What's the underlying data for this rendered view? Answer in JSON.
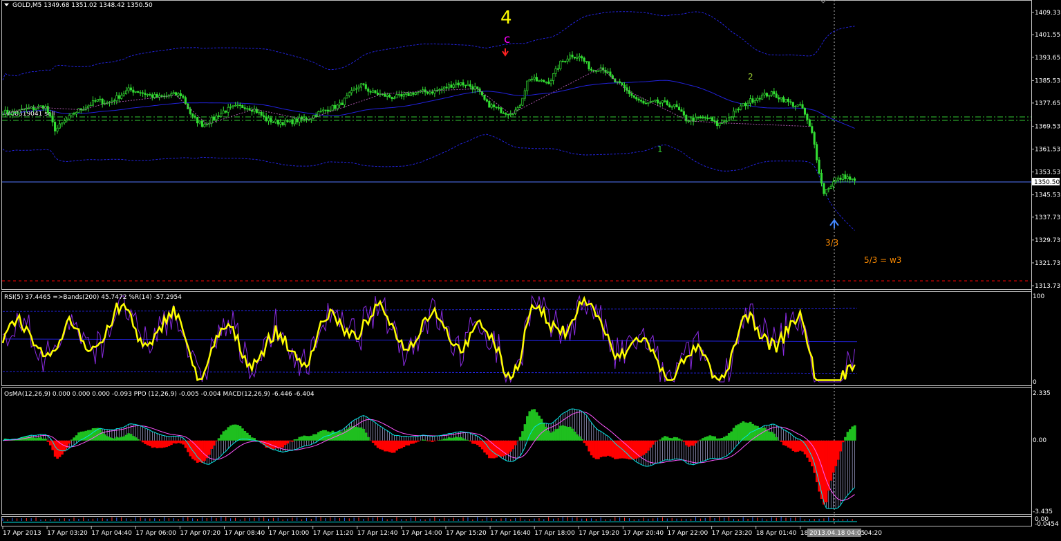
{
  "colors": {
    "background": "#000000",
    "candle": "#33dd33",
    "band": "#2222dd",
    "rsi": "#ffff00",
    "wpr": "#8a2be2",
    "osma_up": "#1fbf1f",
    "osma_down": "#ff0000",
    "macd": "#00e5e5",
    "signal": "#ff55ff",
    "hline_green": "#33cc33",
    "hline_red": "#ff0000",
    "zigzag": "#aa55aa"
  },
  "main": {
    "header": "GOLD,M5  1349.68 1351.02 1348.42 1350.50",
    "order_label": "#88319041 sell",
    "price_ticks": [
      "1409.33",
      "1401.55",
      "1393.65",
      "1385.53",
      "1377.65",
      "1369.53",
      "1361.53",
      "1353.53",
      "1345.53",
      "1337.73",
      "1329.73",
      "1321.73",
      "1313.73"
    ],
    "price_tag": "1350.50",
    "wave_labels": {
      "big4": "4",
      "c": "c",
      "one": "1",
      "two": "2",
      "three3": "3/3",
      "note": "5/3 = w3"
    }
  },
  "rsi_pane": {
    "header": "RSI(5) 37.4465  =>Bands(200) 45.7472  %R(14) -57.2954",
    "ticks": [
      "100",
      "0"
    ]
  },
  "macd_pane": {
    "header": "OsMA(12,26,9) 0.000 0.000 0.000 -0.093  PPO (12,26,9) -0.005 -0.004  MACD(12,26,9) -6.446 -6.404",
    "ticks": [
      "2.335",
      "0.00",
      "-3.435"
    ]
  },
  "bottom_pane": {
    "ticks": [
      "0.00",
      "-0.0454"
    ]
  },
  "time_axis": {
    "labels": [
      "17 Apr 2013",
      "17 Apr 03:20",
      "17 Apr 04:40",
      "17 Apr 06:00",
      "17 Apr 07:20",
      "17 Apr 08:40",
      "17 Apr 10:00",
      "17 Apr 11:20",
      "17 Apr 12:40",
      "17 Apr 14:00",
      "17 Apr 15:20",
      "17 Apr 16:40",
      "17 Apr 18:00",
      "17 Apr 19:20",
      "17 Apr 20:40",
      "17 Apr 22:00",
      "17 Apr 23:20",
      "18 Apr 01:40",
      "18"
    ],
    "cursor_label": "2013.04.18 04:05",
    "last_label": "04:20"
  },
  "chart_data": {
    "type": "candlestick",
    "symbol": "GOLD",
    "timeframe": "M5",
    "ohlc_last": {
      "open": 1349.68,
      "high": 1351.02,
      "low": 1348.42,
      "close": 1350.5
    },
    "ylim": [
      1313.73,
      1409.33
    ],
    "x_tick_labels": [
      "17 Apr 2013",
      "17 Apr 03:20",
      "17 Apr 04:40",
      "17 Apr 06:00",
      "17 Apr 07:20",
      "17 Apr 08:40",
      "17 Apr 10:00",
      "17 Apr 11:20",
      "17 Apr 12:40",
      "17 Apr 14:00",
      "17 Apr 15:20",
      "17 Apr 16:40",
      "17 Apr 18:00",
      "17 Apr 19:20",
      "17 Apr 20:40",
      "17 Apr 22:00",
      "17 Apr 23:20",
      "18 Apr 01:40",
      "18"
    ],
    "price_series": [
      1374.5,
      1374.0,
      1375.4,
      1375.8,
      1376.7,
      1368.2,
      1371.6,
      1374.7,
      1376.5,
      1378.6,
      1377.6,
      1379.9,
      1382.3,
      1381.6,
      1380.3,
      1379.5,
      1380.5,
      1380.6,
      1372.7,
      1370.0,
      1372.1,
      1374.8,
      1376.1,
      1376.5,
      1375.2,
      1371.9,
      1371.0,
      1370.8,
      1371.6,
      1372.2,
      1374.1,
      1375.7,
      1376.8,
      1380.6,
      1384.2,
      1381.5,
      1380.5,
      1379.7,
      1379.8,
      1381.3,
      1381.5,
      1381.7,
      1382.8,
      1384.6,
      1384.2,
      1382.7,
      1377.5,
      1375.5,
      1374.2,
      1375.3,
      1386.6,
      1385.1,
      1385.2,
      1391.5,
      1394.5,
      1393.5,
      1389.1,
      1390.3,
      1385.6,
      1383.1,
      1379.7,
      1377.1,
      1377.9,
      1377.5,
      1376.2,
      1371.8,
      1372.0,
      1372.4,
      1369.9,
      1372.4,
      1375.9,
      1378.3,
      1379.9,
      1381.0,
      1379.4,
      1377.3,
      1376.1,
      1366.3,
      1346.2,
      1350.0,
      1352.1,
      1350.2
    ],
    "wave_labels": [
      "4",
      "c",
      "1",
      "2",
      "3/3",
      "5/3 = w3"
    ],
    "indicators": {
      "rsi": {
        "period": 5,
        "value": 37.4465,
        "bands_period": 200,
        "bands_value": 45.7472,
        "ylim": [
          0,
          100
        ]
      },
      "williams_r": {
        "period": 14,
        "value": -57.2954
      },
      "osma": {
        "params": "12,26,9",
        "values": [
          0.0,
          0.0,
          0.0,
          -0.093
        ]
      },
      "ppo": {
        "params": "12,26,9",
        "values": [
          -0.005,
          -0.004
        ]
      },
      "macd": {
        "params": "12,26,9",
        "values": [
          -6.446,
          -6.404
        ],
        "ylim": [
          -3.435,
          2.335
        ]
      }
    }
  }
}
